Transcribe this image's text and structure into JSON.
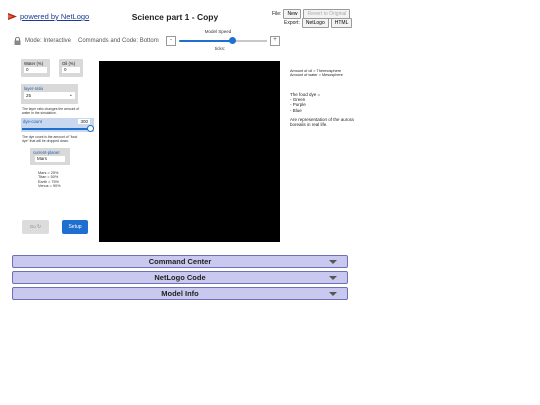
{
  "header": {
    "logo_link": "powered by NetLogo",
    "title": "Science part 1 - Copy",
    "file_label": "File:",
    "new_label": "New",
    "revert_label": "Revert to Original",
    "export_label": "Export:",
    "export_netlogo": "NetLogo",
    "export_html": "HTML"
  },
  "toolbar": {
    "mode_label": "Mode: Interactive",
    "commands_code": "Commands and Code: Bottom",
    "speed_label": "Model Speed",
    "speed_minus": "-",
    "speed_plus": "+",
    "speed_value": 0.6,
    "ticks_label": "ticks:"
  },
  "widgets": {
    "water_monitor": {
      "label": "Water (%)",
      "value": "0"
    },
    "oil_monitor": {
      "label": "Oil (%)",
      "value": "0"
    },
    "layer_chooser": {
      "label": "layer-ratio",
      "value": "25"
    },
    "layer_note": "The layer ratio changes the amount of water in the simulation.",
    "dye_slider": {
      "label": "dye-count",
      "value": "300",
      "fill": 1.0
    },
    "dye_note": "The dye count is the amount of \"food dye\" that will be dropped down.",
    "planet_input": {
      "label": "current-planet",
      "value": "Mars"
    },
    "planet_notes": [
      "Mars = 25%",
      "Titan = 50%",
      "Earth = 75%",
      "Venus = 90%"
    ],
    "go_button": "Go",
    "setup_button": "Setup"
  },
  "notes": {
    "legend": [
      "Amount of oil = Thermosphere",
      "Amount of water = Mesosphere"
    ],
    "dye_title": "The food dye =",
    "dye_colors": [
      "- Green",
      "- Purple",
      "- Blue"
    ],
    "aurora": "Are representation of the aurora borealis in real life."
  },
  "panels": {
    "command_center": "Command Center",
    "netlogo_code": "NetLogo Code",
    "model_info": "Model Info"
  },
  "colors": {
    "accent": "#1f6fd1",
    "panel_bg": "#c9c9ef",
    "link": "#1b3c94"
  }
}
